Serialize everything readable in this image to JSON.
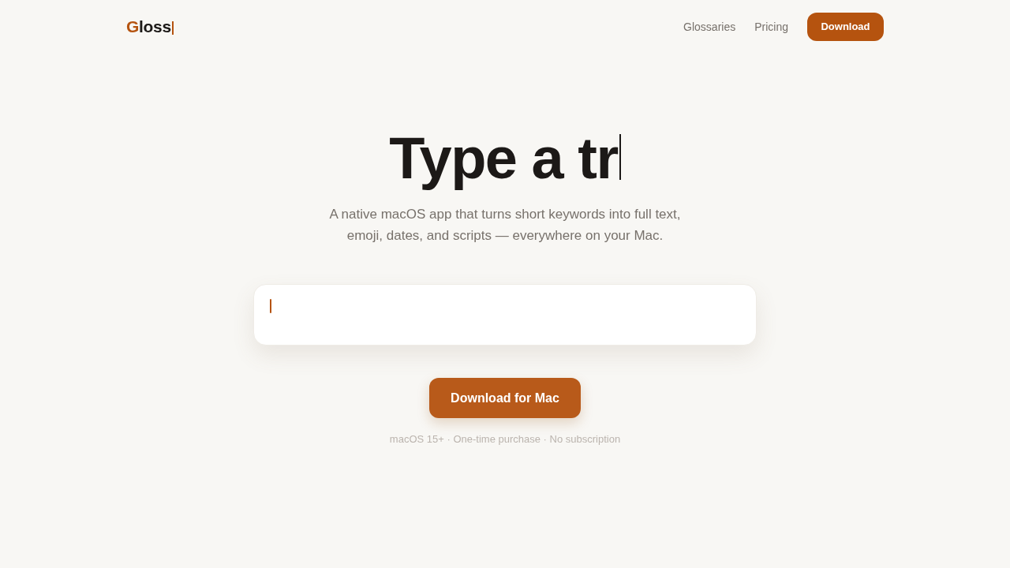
{
  "nav": {
    "logo": {
      "initial": "G",
      "rest": "loss",
      "cursor": true
    },
    "links": [
      "Glossaries",
      "Pricing"
    ],
    "cta": "Download"
  },
  "hero": {
    "headline": "Type a tr",
    "headline_cursor": true,
    "subtitle": "A native macOS app that turns short keywords into full text, emoji, dates, and scripts — everywhere on your Mac.",
    "input": {
      "focused": true
    },
    "button": "Download for Mac",
    "note": "macOS 15+ · One-time purchase · No subscription"
  }
}
